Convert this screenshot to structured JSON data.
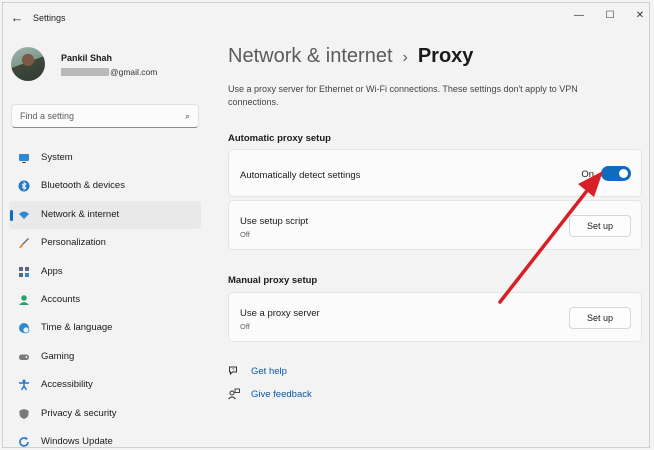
{
  "window": {
    "app_title": "Settings",
    "back_icon": "arrow-left-icon",
    "controls": {
      "minimize": "—",
      "maximize": "☐",
      "close": "✕"
    }
  },
  "user": {
    "name": "Pankil Shah",
    "email_suffix": "@gmail.com"
  },
  "search": {
    "placeholder": "Find a setting",
    "icon": "search-icon"
  },
  "sidebar": {
    "items": [
      {
        "label": "System",
        "icon": "monitor-icon",
        "color": "#2a7ab8"
      },
      {
        "label": "Bluetooth & devices",
        "icon": "bluetooth-icon",
        "color": "#2a7ab8"
      },
      {
        "label": "Network & internet",
        "icon": "wifi-icon",
        "color": "#2a7ab8",
        "active": true
      },
      {
        "label": "Personalization",
        "icon": "brush-icon",
        "color": "#e07a2e"
      },
      {
        "label": "Apps",
        "icon": "apps-icon",
        "color": "#5a6a7a"
      },
      {
        "label": "Accounts",
        "icon": "person-icon",
        "color": "#2aa36b"
      },
      {
        "label": "Time & language",
        "icon": "globe-clock-icon",
        "color": "#2a7ab8"
      },
      {
        "label": "Gaming",
        "icon": "gamepad-icon",
        "color": "#6b6b6b"
      },
      {
        "label": "Accessibility",
        "icon": "accessibility-icon",
        "color": "#2a7ab8"
      },
      {
        "label": "Privacy & security",
        "icon": "shield-icon",
        "color": "#6b6b6b"
      },
      {
        "label": "Windows Update",
        "icon": "update-icon",
        "color": "#2a7ab8"
      }
    ]
  },
  "main": {
    "breadcrumb_parent": "Network & internet",
    "breadcrumb_separator": "›",
    "breadcrumb_current": "Proxy",
    "description": "Use a proxy server for Ethernet or Wi-Fi connections. These settings don't apply to VPN connections.",
    "automatic": {
      "title": "Automatic proxy setup",
      "detect_label": "Automatically detect settings",
      "detect_state": "On",
      "script_label": "Use setup script",
      "script_state": "Off",
      "script_button": "Set up"
    },
    "manual": {
      "title": "Manual proxy setup",
      "proxy_label": "Use a proxy server",
      "proxy_state": "Off",
      "proxy_button": "Set up"
    },
    "links": {
      "help": "Get help",
      "feedback": "Give feedback"
    }
  },
  "colors": {
    "accent": "#0f6cbd",
    "annotation_arrow": "#e3202a"
  }
}
